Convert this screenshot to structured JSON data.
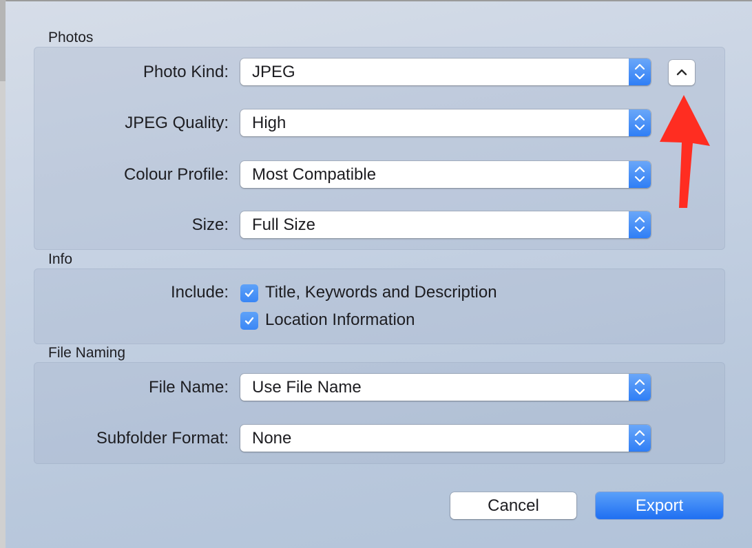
{
  "sections": {
    "photos": {
      "title": "Photos",
      "photo_kind": {
        "label": "Photo Kind:",
        "value": "JPEG"
      },
      "jpeg_quality": {
        "label": "JPEG Quality:",
        "value": "High"
      },
      "colour_profile": {
        "label": "Colour Profile:",
        "value": "Most Compatible"
      },
      "size": {
        "label": "Size:",
        "value": "Full Size"
      }
    },
    "info": {
      "title": "Info",
      "include_label": "Include:",
      "options": [
        {
          "label": "Title, Keywords and Description",
          "checked": true
        },
        {
          "label": "Location Information",
          "checked": true
        }
      ]
    },
    "file_naming": {
      "title": "File Naming",
      "file_name": {
        "label": "File Name:",
        "value": "Use File Name"
      },
      "subfolder_format": {
        "label": "Subfolder Format:",
        "value": "None"
      }
    }
  },
  "buttons": {
    "cancel": "Cancel",
    "export": "Export",
    "collapse_icon": "chevron-up-icon"
  },
  "annotation": {
    "type": "arrow",
    "color": "#ff2d21",
    "points_to": "collapse-details-button"
  },
  "colors": {
    "accent": "#2f7ef6",
    "annotation_red": "#ff2d21"
  }
}
